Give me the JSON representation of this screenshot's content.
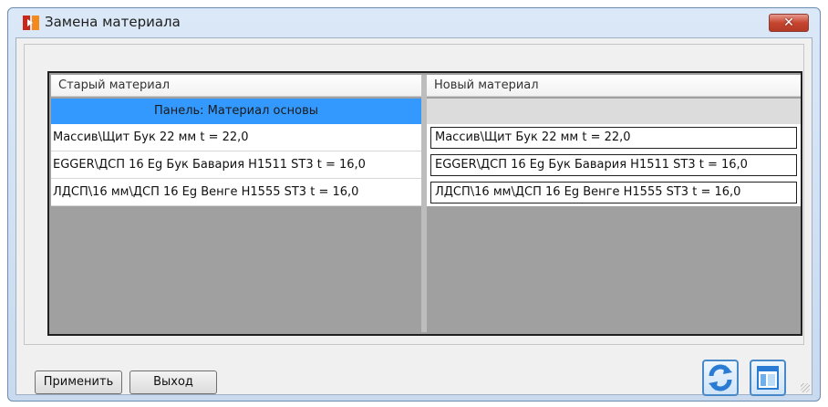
{
  "window": {
    "title": "Замена материала",
    "close_symbol": "✕"
  },
  "table": {
    "columns": [
      "Старый материал",
      "Новый материал"
    ],
    "group_label": "Панель: Материал основы",
    "rows": [
      {
        "old": "Массив\\Щит Бук 22 мм t = 22,0",
        "new": "Массив\\Щит Бук 22 мм t = 22,0"
      },
      {
        "old": "EGGER\\ДСП 16 Eg Бук Бавария H1511 ST3 t = 16,0",
        "new": "EGGER\\ДСП 16 Eg Бук Бавария H1511 ST3 t = 16,0"
      },
      {
        "old": "ЛДСП\\16 мм\\ДСП 16 Eg Венге H1555 ST3 t = 16,0",
        "new": "ЛДСП\\16 мм\\ДСП 16 Eg Венге H1555 ST3 t = 16,0"
      }
    ]
  },
  "buttons": {
    "apply": "Применить",
    "exit": "Выход"
  },
  "icons": {
    "app": "material-replace-icon",
    "refresh": "refresh-arrows-icon",
    "panel": "panel-layout-icon"
  },
  "colors": {
    "selection": "#3399ff",
    "close": "#c7452f",
    "icon_blue": "#2a7bd3"
  }
}
